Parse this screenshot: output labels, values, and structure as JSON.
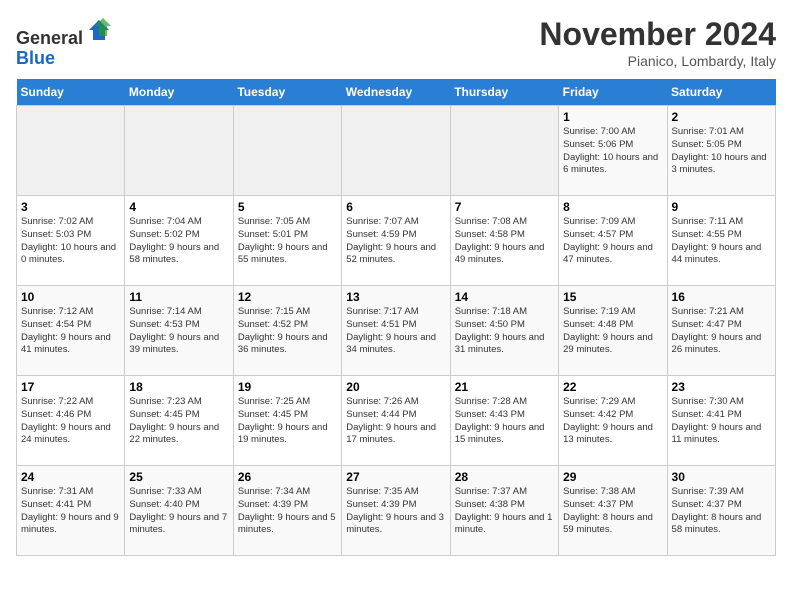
{
  "header": {
    "logo_line1": "General",
    "logo_line2": "Blue",
    "month": "November 2024",
    "location": "Pianico, Lombardy, Italy"
  },
  "days_of_week": [
    "Sunday",
    "Monday",
    "Tuesday",
    "Wednesday",
    "Thursday",
    "Friday",
    "Saturday"
  ],
  "weeks": [
    [
      {
        "day": "",
        "info": ""
      },
      {
        "day": "",
        "info": ""
      },
      {
        "day": "",
        "info": ""
      },
      {
        "day": "",
        "info": ""
      },
      {
        "day": "",
        "info": ""
      },
      {
        "day": "1",
        "info": "Sunrise: 7:00 AM\nSunset: 5:06 PM\nDaylight: 10 hours and 6 minutes."
      },
      {
        "day": "2",
        "info": "Sunrise: 7:01 AM\nSunset: 5:05 PM\nDaylight: 10 hours and 3 minutes."
      }
    ],
    [
      {
        "day": "3",
        "info": "Sunrise: 7:02 AM\nSunset: 5:03 PM\nDaylight: 10 hours and 0 minutes."
      },
      {
        "day": "4",
        "info": "Sunrise: 7:04 AM\nSunset: 5:02 PM\nDaylight: 9 hours and 58 minutes."
      },
      {
        "day": "5",
        "info": "Sunrise: 7:05 AM\nSunset: 5:01 PM\nDaylight: 9 hours and 55 minutes."
      },
      {
        "day": "6",
        "info": "Sunrise: 7:07 AM\nSunset: 4:59 PM\nDaylight: 9 hours and 52 minutes."
      },
      {
        "day": "7",
        "info": "Sunrise: 7:08 AM\nSunset: 4:58 PM\nDaylight: 9 hours and 49 minutes."
      },
      {
        "day": "8",
        "info": "Sunrise: 7:09 AM\nSunset: 4:57 PM\nDaylight: 9 hours and 47 minutes."
      },
      {
        "day": "9",
        "info": "Sunrise: 7:11 AM\nSunset: 4:55 PM\nDaylight: 9 hours and 44 minutes."
      }
    ],
    [
      {
        "day": "10",
        "info": "Sunrise: 7:12 AM\nSunset: 4:54 PM\nDaylight: 9 hours and 41 minutes."
      },
      {
        "day": "11",
        "info": "Sunrise: 7:14 AM\nSunset: 4:53 PM\nDaylight: 9 hours and 39 minutes."
      },
      {
        "day": "12",
        "info": "Sunrise: 7:15 AM\nSunset: 4:52 PM\nDaylight: 9 hours and 36 minutes."
      },
      {
        "day": "13",
        "info": "Sunrise: 7:17 AM\nSunset: 4:51 PM\nDaylight: 9 hours and 34 minutes."
      },
      {
        "day": "14",
        "info": "Sunrise: 7:18 AM\nSunset: 4:50 PM\nDaylight: 9 hours and 31 minutes."
      },
      {
        "day": "15",
        "info": "Sunrise: 7:19 AM\nSunset: 4:48 PM\nDaylight: 9 hours and 29 minutes."
      },
      {
        "day": "16",
        "info": "Sunrise: 7:21 AM\nSunset: 4:47 PM\nDaylight: 9 hours and 26 minutes."
      }
    ],
    [
      {
        "day": "17",
        "info": "Sunrise: 7:22 AM\nSunset: 4:46 PM\nDaylight: 9 hours and 24 minutes."
      },
      {
        "day": "18",
        "info": "Sunrise: 7:23 AM\nSunset: 4:45 PM\nDaylight: 9 hours and 22 minutes."
      },
      {
        "day": "19",
        "info": "Sunrise: 7:25 AM\nSunset: 4:45 PM\nDaylight: 9 hours and 19 minutes."
      },
      {
        "day": "20",
        "info": "Sunrise: 7:26 AM\nSunset: 4:44 PM\nDaylight: 9 hours and 17 minutes."
      },
      {
        "day": "21",
        "info": "Sunrise: 7:28 AM\nSunset: 4:43 PM\nDaylight: 9 hours and 15 minutes."
      },
      {
        "day": "22",
        "info": "Sunrise: 7:29 AM\nSunset: 4:42 PM\nDaylight: 9 hours and 13 minutes."
      },
      {
        "day": "23",
        "info": "Sunrise: 7:30 AM\nSunset: 4:41 PM\nDaylight: 9 hours and 11 minutes."
      }
    ],
    [
      {
        "day": "24",
        "info": "Sunrise: 7:31 AM\nSunset: 4:41 PM\nDaylight: 9 hours and 9 minutes."
      },
      {
        "day": "25",
        "info": "Sunrise: 7:33 AM\nSunset: 4:40 PM\nDaylight: 9 hours and 7 minutes."
      },
      {
        "day": "26",
        "info": "Sunrise: 7:34 AM\nSunset: 4:39 PM\nDaylight: 9 hours and 5 minutes."
      },
      {
        "day": "27",
        "info": "Sunrise: 7:35 AM\nSunset: 4:39 PM\nDaylight: 9 hours and 3 minutes."
      },
      {
        "day": "28",
        "info": "Sunrise: 7:37 AM\nSunset: 4:38 PM\nDaylight: 9 hours and 1 minute."
      },
      {
        "day": "29",
        "info": "Sunrise: 7:38 AM\nSunset: 4:37 PM\nDaylight: 8 hours and 59 minutes."
      },
      {
        "day": "30",
        "info": "Sunrise: 7:39 AM\nSunset: 4:37 PM\nDaylight: 8 hours and 58 minutes."
      }
    ]
  ]
}
